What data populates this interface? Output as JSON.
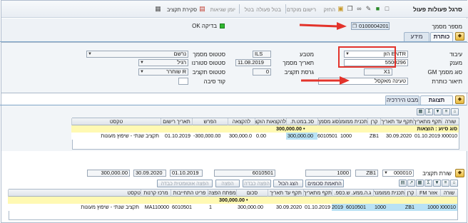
{
  "toolbar": {
    "title": "סרגל פעולות פעול",
    "items": [
      {
        "label": "סקירת תקציב",
        "disabled": false
      },
      {
        "label": "יומן שגיאות",
        "disabled": true
      },
      {
        "label": "בטל",
        "disabled": true
      },
      {
        "label": "בטל פעולה",
        "disabled": true
      },
      {
        "label": "רישום מוקדם",
        "disabled": true
      },
      {
        "label": "החזק",
        "disabled": true
      }
    ],
    "icons": [
      "new-icon",
      "save-icon",
      "edit-icon",
      "glasses-icon",
      "copy-icon",
      "undo-icon",
      "print-icon",
      "folder-icon"
    ]
  },
  "header": {
    "doc_number_label": "מספר מסמך",
    "doc_number": "0100004201",
    "check_label": "בדיקה OK",
    "check_color": "#2fb82f"
  },
  "tabs_main": [
    {
      "label": "כותרת",
      "active": true
    },
    {
      "label": "מידע נוסף",
      "active": false
    }
  ],
  "form": {
    "entity_label": "עיבוד",
    "entity_value": "ENTR הזן",
    "currency_label": "מטבע",
    "currency_value": "ILS",
    "doc_status_label": "סטטוס מסמך",
    "doc_status_value": "נרשם",
    "recipient_label": "מענק",
    "recipient_value": "5500296",
    "doc_date_label": "תאריך מסמך",
    "doc_date_value": "11.08.2019",
    "reverse_status_label": "סטטוס סטורנו",
    "reverse_status_value": "רגיל",
    "doc_type_label": "סוג מסמך GM",
    "doc_type_value": "X1",
    "budget_version_label": "גרסת תקציב",
    "budget_version_value": "0",
    "budget_status_label": "סטטוס תקציב",
    "budget_status_value": "R שוחרר",
    "header_desc_label": "תיאור כותרת",
    "header_desc_value": "טעינה מאקסל",
    "reason_code_label": "קוד סיבה",
    "reason_code_value": ""
  },
  "tabs_mid": [
    {
      "label": "תצוגת רשמה",
      "active": true
    },
    {
      "label": "מבט היררכיה",
      "active": false
    }
  ],
  "table1": {
    "columns": [
      "שורה",
      "תקף מתאריך",
      "תקף עד תאריך",
      "קרן",
      "תכנית ממומנת",
      "סוג מסמך",
      "סכ.במט.ת.",
      "להקצאות הוקצה",
      "להקצאה",
      "הפרש",
      "תאריך רישום",
      "טקסט"
    ],
    "group_label": "סוג סיוע : הוצאות",
    "group_total": "300,000.00 •",
    "rows": [
      {
        "line": "000010",
        "valid_from": "01.10.2019",
        "valid_to": "30.09.2020",
        "fund": "ZB1",
        "funded_program": "1000",
        "doc_type": "6010501",
        "amount": "300,000.00",
        "allocated": "0.00",
        "to_allocate": "300,000.0",
        "diff": "-300,000.00",
        "post_date": "01.10.2019",
        "text": "תקציב שנתי - שיפוץ מעונות"
      }
    ]
  },
  "line_budget": {
    "label": "שורת תקציב",
    "line_value": "000010",
    "fields": [
      "ZB1",
      "1000",
      "6010501",
      "01.10.2019",
      "30.09.2020",
      "300,000.00"
    ]
  },
  "buttons": [
    {
      "label": "הצג הכול",
      "disabled": false
    },
    {
      "label": "התאמת סכומים",
      "disabled": false
    },
    {
      "label": "הפצה כבדה",
      "disabled": true
    },
    {
      "label": "הפצה",
      "disabled": true
    },
    {
      "label": "הפצה אוטומטית כבדה",
      "disabled": true
    }
  ],
  "table2": {
    "columns": [
      "שורה",
      "אזור FM",
      "קרן",
      "תכנית ממומנת",
      "ג.ה.ממע. ש.כספ.",
      "תקף מתאריך",
      "תקף עד תאריך",
      "סכום",
      "מפתח הפצה",
      "פריט התחייבות",
      "מרכז קרנות",
      "טקסט"
    ],
    "group_total": "300,000.00 •",
    "rows": [
      {
        "line": "000010",
        "fm_area": "1000",
        "fund": "ZB1",
        "funded_program": "1000",
        "gp": "6010501",
        "year": "2019",
        "valid_from": "01.10.2019",
        "valid_to": "30.09.2020",
        "amount": "300,000.00",
        "dist_key": "1",
        "commitment_item": "6010501",
        "funds_center": "MA110000",
        "text": "תקציב שנתי - שיפוץ מעונות"
      }
    ]
  },
  "colors": {
    "highlight_red": "#e3332b",
    "yellow_row": "#fff9b3",
    "blue_row": "#b9e2f5"
  }
}
